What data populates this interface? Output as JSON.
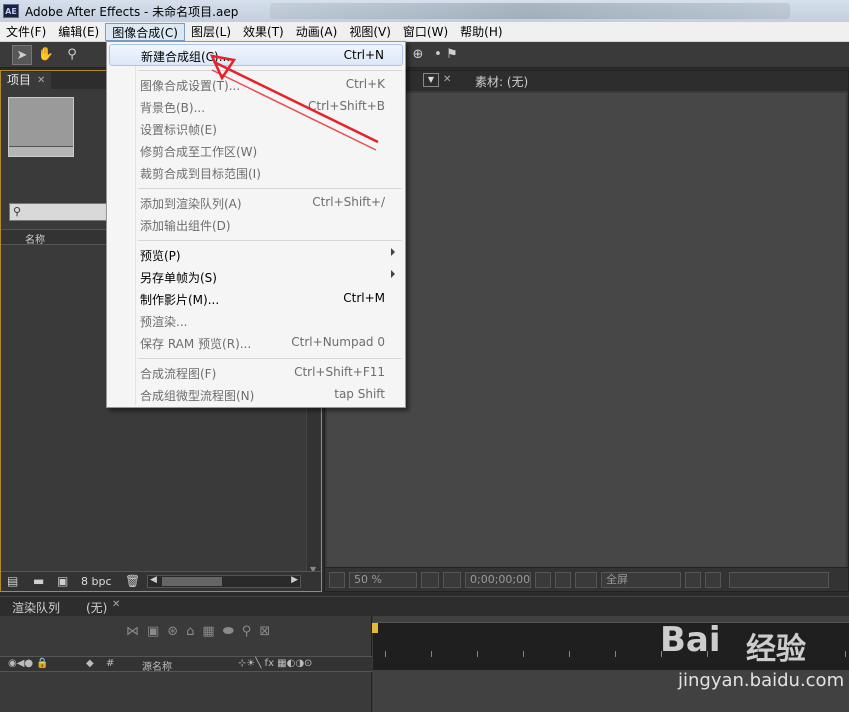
{
  "window": {
    "title": "Adobe After Effects - 未命名项目.aep",
    "logo_text": "AE"
  },
  "menubar": [
    "文件(F)",
    "编辑(E)",
    "图像合成(C)",
    "图层(L)",
    "效果(T)",
    "动画(A)",
    "视图(V)",
    "窗口(W)",
    "帮助(H)"
  ],
  "project_panel": {
    "tab_label": "项目",
    "column_name": "名称",
    "bit_depth": "8 bpc"
  },
  "composition_panel": {
    "footage_tab": "素材: (无)",
    "zoom": "50 %",
    "timecode": "0;00;00;00",
    "resolution": "全屏"
  },
  "bottom_tabs": {
    "render_queue": "渲染队列",
    "comp_none": "(无)"
  },
  "timeline": {
    "source_name_header": "源名称"
  },
  "dropdown_menu": {
    "items": [
      {
        "label": "新建合成组(C)...",
        "shortcut": "Ctrl+N",
        "enabled": true,
        "highlighted": true
      },
      {
        "label": "图像合成设置(T)...",
        "shortcut": "Ctrl+K",
        "enabled": false
      },
      {
        "label": "背景色(B)...",
        "shortcut": "Ctrl+Shift+B",
        "enabled": false
      },
      {
        "label": "设置标识帧(E)",
        "shortcut": "",
        "enabled": false
      },
      {
        "label": "修剪合成至工作区(W)",
        "shortcut": "",
        "enabled": false
      },
      {
        "label": "裁剪合成到目标范围(I)",
        "shortcut": "",
        "enabled": false
      },
      {
        "label": "添加到渲染队列(A)",
        "shortcut": "Ctrl+Shift+/",
        "enabled": false
      },
      {
        "label": "添加输出组件(D)",
        "shortcut": "",
        "enabled": false
      },
      {
        "label": "预览(P)",
        "shortcut": "",
        "enabled": true,
        "submenu": true
      },
      {
        "label": "另存单帧为(S)",
        "shortcut": "",
        "enabled": true,
        "submenu": true
      },
      {
        "label": "制作影片(M)...",
        "shortcut": "Ctrl+M",
        "enabled": true
      },
      {
        "label": "预渲染...",
        "shortcut": "",
        "enabled": false
      },
      {
        "label": "保存 RAM 预览(R)...",
        "shortcut": "Ctrl+Numpad 0",
        "enabled": false
      },
      {
        "label": "合成流程图(F)",
        "shortcut": "Ctrl+Shift+F11",
        "enabled": false
      },
      {
        "label": "合成组微型流程图(N)",
        "shortcut": "tap Shift",
        "enabled": false
      }
    ]
  },
  "watermark": {
    "brand": "Bai",
    "brand_suffix": "经验",
    "url": "jingyan.baidu.com"
  },
  "colors": {
    "annotation_arrow": "#e8202a",
    "panel_border_active": "#b58a22",
    "menu_highlight": "#dbe8f9"
  }
}
